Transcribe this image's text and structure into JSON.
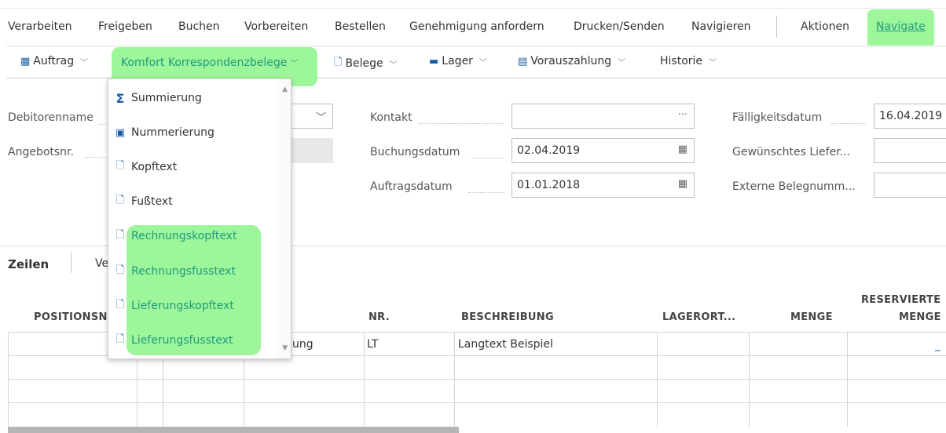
{
  "top_menu": {
    "items": [
      "Verarbeiten",
      "Freigeben",
      "Buchen",
      "Vorbereiten",
      "Bestellen",
      "Genehmigung anfordern",
      "Drucken/Senden",
      "Navigieren",
      "Aktionen"
    ],
    "navigate_label": "Navigate"
  },
  "sub_menu": {
    "auftrag": "Auftrag",
    "komfort": "Komfort Korrespondenzbelege",
    "belege": "Belege",
    "lager": "Lager",
    "vorauszahlung": "Vorauszahlung",
    "historie": "Historie"
  },
  "header": {
    "debitorenname_label": "Debitorenname",
    "angebotsnr_label": "Angebotsnr.",
    "kontakt_label": "Kontakt",
    "kontakt_value": "",
    "buchungsdatum_label": "Buchungsdatum",
    "buchungsdatum_value": "02.04.2019",
    "auftragsdatum_label": "Auftragsdatum",
    "auftragsdatum_value": "01.01.2018",
    "faelligkeitsdatum_label": "Fälligkeitsdatum",
    "faelligkeitsdatum_value": "16.04.2019",
    "gewuenschtes_label": "Gewünschtes Liefer...",
    "externe_label": "Externe Belegnumm..."
  },
  "lines": {
    "tab_zeilen": "Zeilen",
    "tab_ve": "Ve",
    "columns": {
      "positionsnr": "POSITIONSNU",
      "nr": "NR.",
      "beschreibung": "BESCHREIBUNG",
      "lagerort": "LAGERORT...",
      "menge": "MENGE",
      "reservierte_1": "RESERVIERTE",
      "reservierte_2": "MENGE"
    },
    "row1": {
      "typ": "ung",
      "nr": "LT",
      "beschreibung": "Langtext Beispiel",
      "reserviert": "_"
    }
  },
  "dropdown": {
    "items": [
      "Summierung",
      "Nummerierung",
      "Kopftext",
      "Fußtext",
      "Rechnungskopftext",
      "Rechnungsfusstext",
      "Lieferungskopftext",
      "Lieferungsfusstext"
    ]
  },
  "colors": {
    "highlight": "#9df79a",
    "link_green": "#1e9a7d",
    "icon_blue": "#1a5ea8"
  }
}
